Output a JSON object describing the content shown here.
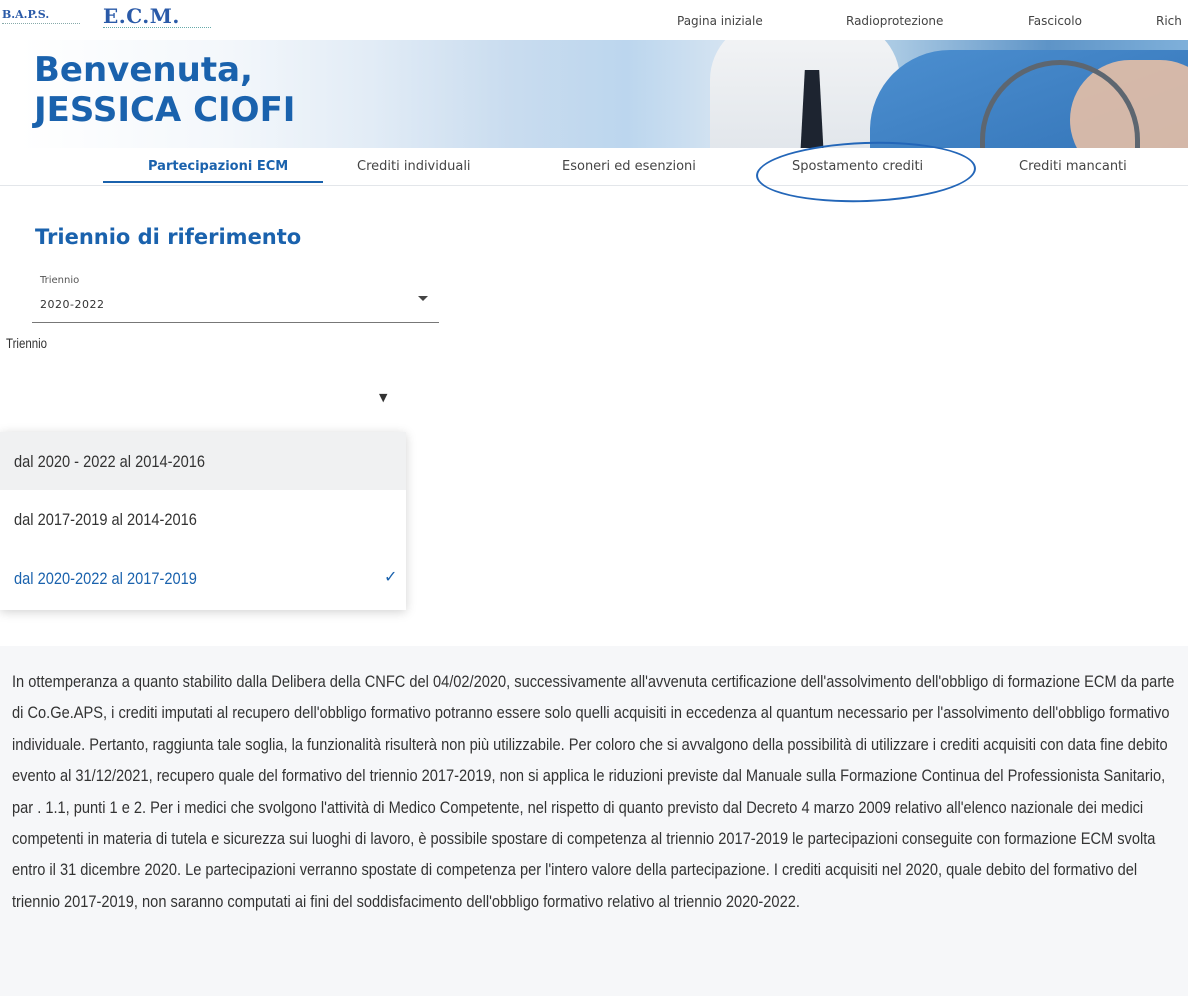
{
  "header": {
    "logo_aps": "B.A.P.S.",
    "logo_ecm": "E.C.M.",
    "nav": [
      "Pagina iniziale",
      "Radioprotezione",
      "Fascicolo",
      "Rich"
    ]
  },
  "hero": {
    "greeting": "Benvenuta,",
    "user_name": "JESSICA CIOFI"
  },
  "tabs": [
    {
      "label": "Partecipazioni ECM",
      "active": true
    },
    {
      "label": "Crediti individuali",
      "active": false
    },
    {
      "label": "Esoneri ed esenzioni",
      "active": false
    },
    {
      "label": "Spostamento crediti",
      "active": false
    },
    {
      "label": "Crediti mancanti",
      "active": false
    }
  ],
  "section": {
    "title": "Triennio di riferimento",
    "select_label": "Triennio",
    "select_value": "2020-2022"
  },
  "dropdown": {
    "label": "Triennio",
    "options": [
      {
        "label": "dal 2020 - 2022 al 2014-2016",
        "highlighted": true,
        "selected": false
      },
      {
        "label": "dal 2017-2019 al 2014-2016",
        "highlighted": false,
        "selected": false
      },
      {
        "label": "dal 2020-2022 al 2017-2019",
        "highlighted": false,
        "selected": true
      }
    ],
    "check_mark": "✓"
  },
  "notice": {
    "text": "In ottemperanza a quanto stabilito dalla Delibera della CNFC del 04/02/2020, successivamente all'avvenuta certificazione dell'assolvimento dell'obbligo di formazione ECM da parte di Co.Ge.APS, i crediti imputati al recupero dell'obbligo formativo potranno essere solo quelli acquisiti in eccedenza al quantum necessario per l'assolvimento dell'obbligo formativo individuale. Pertanto, raggiunta tale soglia, la funzionalità risulterà non più utilizzabile. Per coloro che si avvalgono della possibilità di utilizzare i crediti acquisiti con data fine debito evento al 31/12/2021, recupero quale del formativo del triennio 2017-2019, non si applica le riduzioni previste dal Manuale sulla Formazione Continua del Professionista Sanitario, par . 1.1, punti 1 e 2. Per i medici che svolgono l'attività di Medico Competente, nel rispetto di quanto previsto dal Decreto 4 marzo 2009 relativo all'elenco nazionale dei medici competenti in materia di tutela e sicurezza sui luoghi di lavoro, è possibile spostare di competenza al triennio 2017-2019 le partecipazioni conseguite con formazione ECM svolta entro il 31 dicembre 2020. Le partecipazioni verranno spostate di competenza per l'intero valore della partecipazione. I crediti acquisiti nel 2020, quale debito del formativo del triennio 2017-2019, non saranno computati ai fini del soddisfacimento dell'obbligo formativo relativo al triennio 2020-2022."
  },
  "colors": {
    "brand_blue": "#1a62ad",
    "annotation_blue": "#2366b8"
  }
}
